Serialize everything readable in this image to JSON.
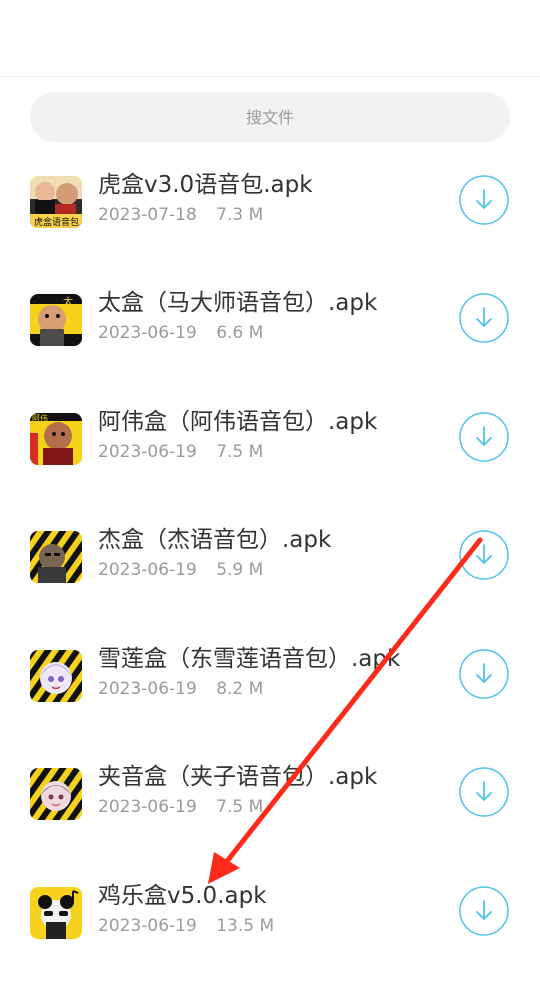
{
  "search": {
    "placeholder": "搜文件"
  },
  "files": [
    {
      "name": "虎盒v3.0语音包.apk",
      "date": "2023-07-18",
      "size": "7.3 M",
      "icon": "tiger-box-icon"
    },
    {
      "name": "太盒（马大师语音包）.apk",
      "date": "2023-06-19",
      "size": "6.6 M",
      "icon": "tai-box-icon"
    },
    {
      "name": "阿伟盒（阿伟语音包）.apk",
      "date": "2023-06-19",
      "size": "7.5 M",
      "icon": "awei-box-icon"
    },
    {
      "name": "杰盒（杰语音包）.apk",
      "date": "2023-06-19",
      "size": "5.9 M",
      "icon": "jie-box-icon"
    },
    {
      "name": "雪莲盒（东雪莲语音包）.apk",
      "date": "2023-06-19",
      "size": "8.2 M",
      "icon": "xuelian-box-icon"
    },
    {
      "name": "夹音盒（夹子语音包）.apk",
      "date": "2023-06-19",
      "size": "7.5 M",
      "icon": "jiayin-box-icon"
    },
    {
      "name": "鸡乐盒v5.0.apk",
      "date": "2023-06-19",
      "size": "13.5 M",
      "icon": "jile-box-icon"
    }
  ],
  "colors": {
    "accent": "#4fc4e8",
    "arrow": "#ff2a1a",
    "search_bg": "#f2f2f2",
    "meta_text": "#9b9b9b"
  }
}
